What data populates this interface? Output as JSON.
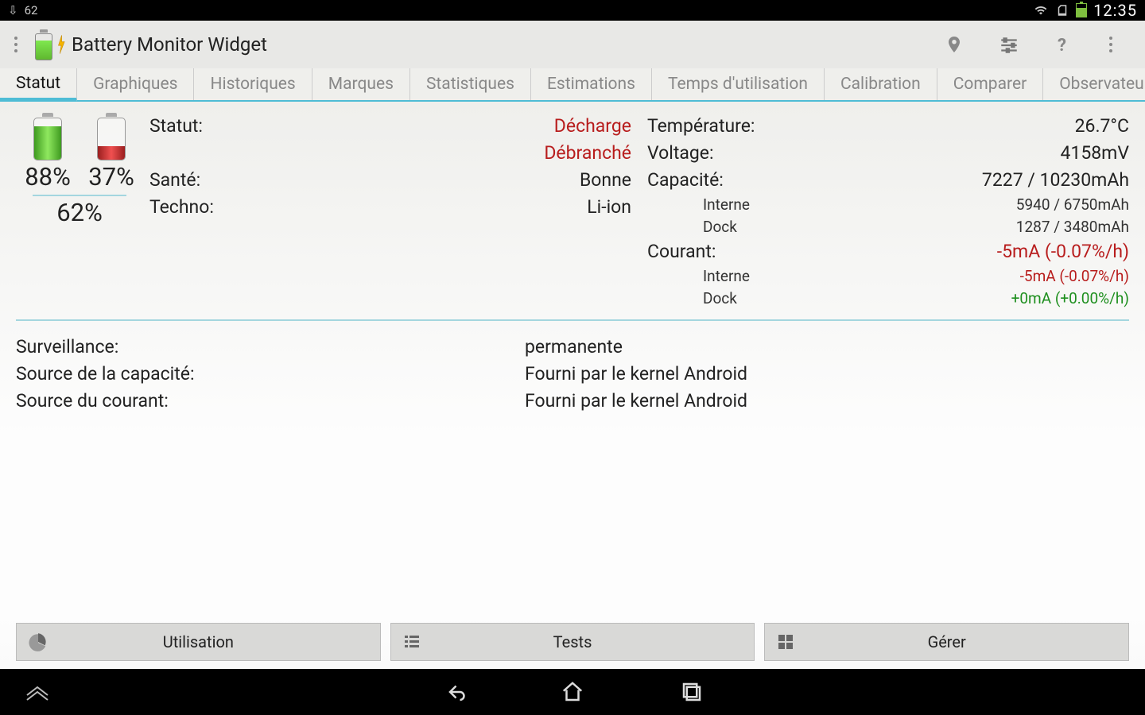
{
  "status_bar": {
    "left_text": "62",
    "clock": "12:35"
  },
  "app_title": "Battery Monitor Widget",
  "tabs": [
    "Statut",
    "Graphiques",
    "Historiques",
    "Marques",
    "Statistiques",
    "Estimations",
    "Temps d'utilisation",
    "Calibration",
    "Comparer",
    "Observateur"
  ],
  "active_tab_index": 0,
  "batteries": {
    "pct1": "88%",
    "pct2": "37%",
    "pct_total": "62%"
  },
  "col1": {
    "statut_label": "Statut:",
    "statut_value": "Décharge",
    "plug_value": "Débranché",
    "sante_label": "Santé:",
    "sante_value": "Bonne",
    "techno_label": "Techno:",
    "techno_value": "Li-ion"
  },
  "col2": {
    "temp_label": "Température:",
    "temp_value": "26.7°C",
    "volt_label": "Voltage:",
    "volt_value": "4158mV",
    "cap_label": "Capacité:",
    "cap_value": "7227 / 10230mAh",
    "cap_interne_label": "Interne",
    "cap_interne_value": "5940 / 6750mAh",
    "cap_dock_label": "Dock",
    "cap_dock_value": "1287 / 3480mAh",
    "cour_label": "Courant:",
    "cour_value": "-5mA (-0.07%/h)",
    "cour_interne_label": "Interne",
    "cour_interne_value": "-5mA (-0.07%/h)",
    "cour_dock_label": "Dock",
    "cour_dock_value": "+0mA (+0.00%/h)"
  },
  "bottom_info": {
    "surveillance_label": "Surveillance:",
    "surveillance_value": "permanente",
    "src_cap_label": "Source de la capacité:",
    "src_cap_value": "Fourni par le kernel Android",
    "src_cour_label": "Source du courant:",
    "src_cour_value": "Fourni par le kernel Android"
  },
  "buttons": {
    "utilisation": "Utilisation",
    "tests": "Tests",
    "gerer": "Gérer"
  }
}
